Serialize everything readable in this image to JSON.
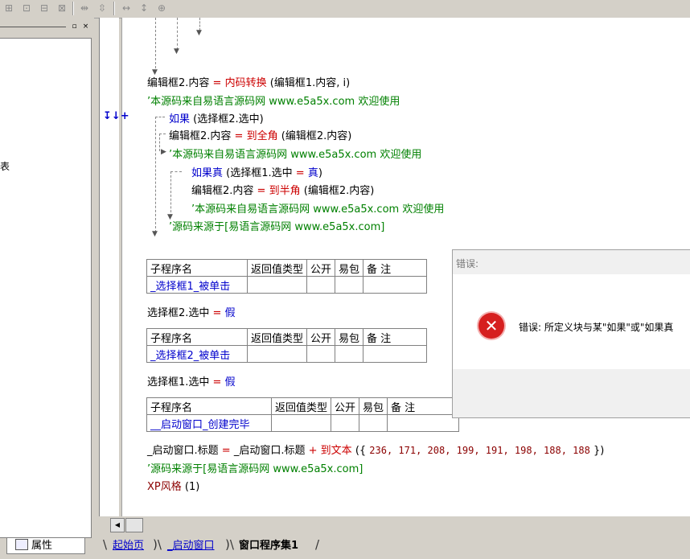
{
  "toolbar": {
    "icons": [
      "table-insert-row-icon",
      "table-insert-col-icon",
      "table-merge-icon",
      "table-split-icon",
      "align-horizontal-icon",
      "align-vertical-icon",
      "width-icon",
      "height-icon",
      "size-icon"
    ]
  },
  "left_panel": {
    "fragment_text": "表",
    "properties_tab": "属性",
    "pin_glyph": "▫",
    "close_glyph": "×"
  },
  "gutter": {
    "marker": "↧↓+"
  },
  "code": {
    "line1": {
      "a": "编辑框2.内容",
      "eq": "=",
      "fn": "内码转换",
      "args": "(编辑框1.内容, i)"
    },
    "line2": "’本源码来自易语言源码网 www.e5a5x.com  欢迎使用",
    "line3": {
      "kw": "如果",
      "args": "(选择框2.选中)"
    },
    "line4": {
      "a": "编辑框2.内容",
      "eq": "=",
      "fn": "到全角",
      "args": "(编辑框2.内容)"
    },
    "line5": "’本源码来自易语言源码网 www.e5a5x.com  欢迎使用",
    "line6": {
      "kw": "如果真",
      "args": "(选择框1.选中",
      "eq": "=",
      "val": "真",
      "close": ")"
    },
    "line7": {
      "a": "编辑框2.内容",
      "eq": "=",
      "fn": "到半角",
      "args": "(编辑框2.内容)"
    },
    "line8": "’本源码来自易语言源码网 www.e5a5x.com  欢迎使用",
    "line9": "’源码来源于[易语言源码网 www.e5a5x.com]"
  },
  "tables": {
    "headers": {
      "name": "子程序名",
      "ret": "返回值类型",
      "public": "公开",
      "easy": "易包",
      "note": "备 注"
    },
    "t1_name": "_选择框1_被单击",
    "t1_stmt": {
      "a": "选择框2.选中",
      "eq": "=",
      "val": "假"
    },
    "t2_name": "_选择框2_被单击",
    "t2_stmt": {
      "a": "选择框1.选中",
      "eq": "=",
      "val": "假"
    },
    "t3_name": "__启动窗口_创建完毕"
  },
  "code2": {
    "line1": {
      "a": "_启动窗口.标题",
      "eq": "=",
      "b": "_启动窗口.标题",
      "plus": "+",
      "fn": "到文本",
      "open": "({",
      "nums": "236, 171, 208, 199, 191, 198, 188, 188",
      "close": "})"
    },
    "line2": "’源码来源于[易语言源码网 www.e5a5x.com]",
    "line3": {
      "fn": "XP风格",
      "args": "(1)"
    }
  },
  "dialog": {
    "title": "错误:",
    "message": "错误: 所定义块与某\"如果\"或\"如果真",
    "icon_glyph": "✕"
  },
  "scrollbar": {
    "left_glyph": "◀"
  },
  "tabs": [
    {
      "label": "起始页",
      "active": false
    },
    {
      "label": "_启动窗口",
      "active": false
    },
    {
      "label": "窗口程序集1",
      "active": true
    }
  ]
}
